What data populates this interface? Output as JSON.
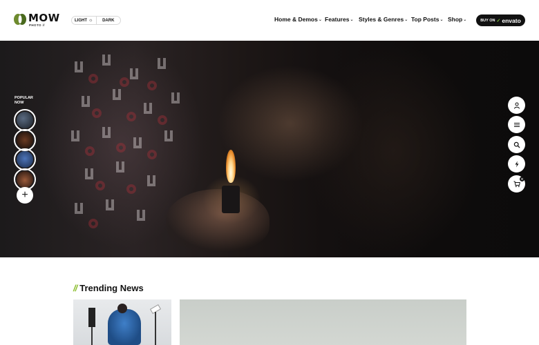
{
  "header": {
    "logo_text": "MOW",
    "logo_sub": "PHOTO //",
    "mode_light": "LIGHT",
    "mode_dark": "DARK",
    "nav": [
      {
        "label": "Home & Demos"
      },
      {
        "label": "Features"
      },
      {
        "label": "Styles & Genres"
      },
      {
        "label": "Top Posts"
      },
      {
        "label": "Shop"
      }
    ],
    "buy_prefix": "BUY ON",
    "buy_brand": "envato"
  },
  "hero": {
    "stories_label": "POPULAR NOW",
    "stories": [
      {
        "icon": "story-thumbnail"
      },
      {
        "icon": "story-thumbnail"
      },
      {
        "icon": "story-thumbnail"
      },
      {
        "icon": "story-thumbnail"
      }
    ],
    "side_buttons": [
      "user-icon",
      "menu-icon",
      "search-icon",
      "lightning-icon",
      "cart-icon"
    ],
    "cart_count": "0"
  },
  "trending": {
    "title": "Trending News"
  },
  "colors": {
    "accent": "#8bbd2e",
    "dark": "#111111"
  }
}
